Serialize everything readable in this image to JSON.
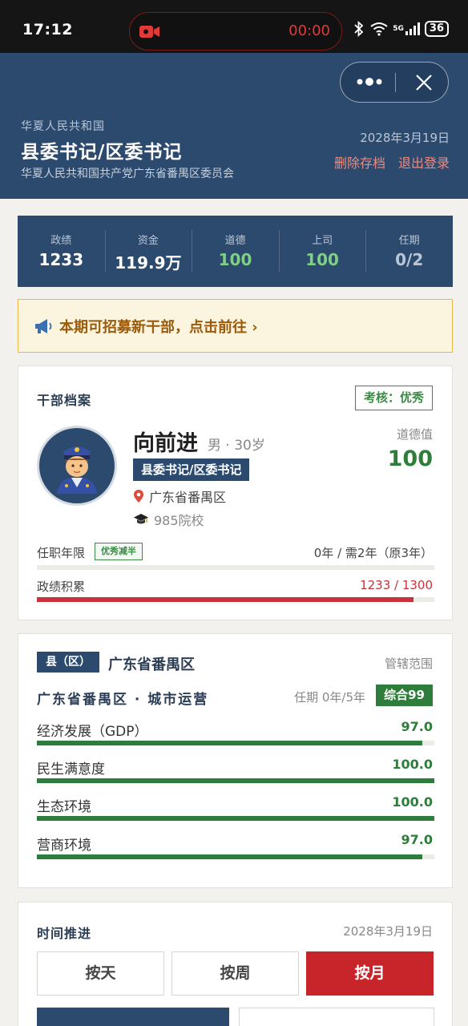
{
  "status_bar": {
    "time": "17:12",
    "recording_time": "00:00",
    "network": "5G",
    "battery": "36"
  },
  "header": {
    "country": "华夏人民共和国",
    "title": "县委书记/区委书记",
    "organization": "华夏人民共和国共产党广东省番禺区委员会",
    "date": "2028年3月19日",
    "delete_save": "删除存档",
    "logout": "退出登录"
  },
  "stats": [
    {
      "label": "政绩",
      "value": "1233",
      "color": "#ffffff"
    },
    {
      "label": "资金",
      "value": "119.9万",
      "color": "#ffffff"
    },
    {
      "label": "道德",
      "value": "100",
      "color": "#7fcf86"
    },
    {
      "label": "上司",
      "value": "100",
      "color": "#7fcf86"
    },
    {
      "label": "任期",
      "value": "0/2",
      "color": "#b9c6d8"
    }
  ],
  "notice": {
    "text": "本期可招募新干部，点击前往 ›",
    "icon": "megaphone-icon"
  },
  "profile": {
    "section_title": "干部档案",
    "assessment": "考核：优秀",
    "name": "向前进",
    "meta": "男 · 30岁",
    "post": "县委书记/区委书记",
    "location": "广东省番禺区",
    "school": "985院校",
    "moral_label": "道德值",
    "moral_value": "100",
    "tenure_label": "任职年限",
    "tenure_badge": "优秀减半",
    "tenure_value": "0年 / 需2年（原3年）",
    "tenure_progress": 0,
    "merit_label": "政绩积累",
    "merit_value": "1233 / 1300",
    "merit_progress": 0.948
  },
  "region": {
    "tag": "县（区）",
    "name": "广东省番禺区",
    "scope_link": "管辖范围",
    "focus": "广东省番禺区 · 城市运营",
    "term": "任期 0年/5年",
    "score": "综合99",
    "metrics": [
      {
        "label": "经济发展（GDP）",
        "value": "97.0",
        "progress": 0.97
      },
      {
        "label": "民生满意度",
        "value": "100.0",
        "progress": 1.0
      },
      {
        "label": "生态环境",
        "value": "100.0",
        "progress": 1.0
      },
      {
        "label": "营商环境",
        "value": "97.0",
        "progress": 0.97
      }
    ]
  },
  "time_advance": {
    "title": "时间推进",
    "date": "2028年3月19日",
    "options": [
      "按天",
      "按周",
      "按月"
    ],
    "selected": "按月"
  },
  "colors": {
    "navy": "#2c4a6e",
    "green": "#2f7d3a",
    "red": "#c8252b",
    "merit_bar": "#c8323a"
  }
}
